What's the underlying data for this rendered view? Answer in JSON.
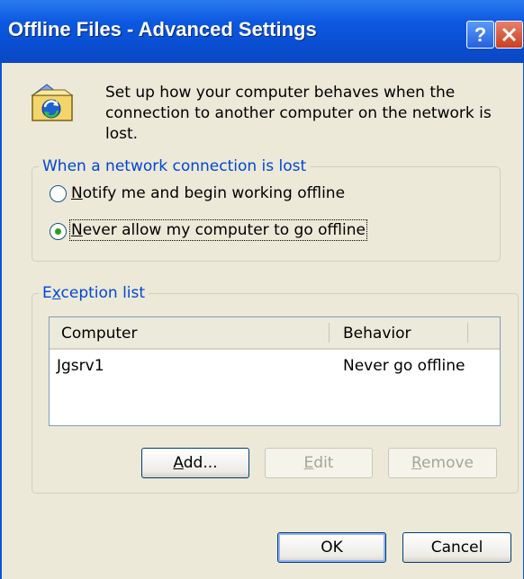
{
  "window": {
    "title": "Offline Files - Advanced Settings",
    "help_glyph": "?",
    "colors": {
      "titlebar": "#0a56d8",
      "client": "#ece9d8",
      "group_title": "#0046d5",
      "radio_dot": "#21a121"
    }
  },
  "description": "Set up how your computer behaves when the connection to another computer on the network is lost.",
  "icons": {
    "info": "offline-files-icon",
    "close": "close-icon",
    "help": "help-icon"
  },
  "network_group": {
    "title": "When a network connection is lost",
    "options": [
      {
        "mnemonic": "N",
        "rest": "otify me and begin working offline",
        "selected": false
      },
      {
        "mnemonic": "N",
        "rest": "ever allow my computer to go offline",
        "selected": true
      }
    ]
  },
  "exception_group": {
    "title_pre": "E",
    "title_mnemonic": "x",
    "title_post": "ception list",
    "columns": [
      "Computer",
      "Behavior"
    ],
    "rows": [
      {
        "computer": "Jgsrv1",
        "behavior": "Never go offline"
      }
    ],
    "buttons": {
      "add": {
        "mnemonic": "A",
        "rest": "dd..."
      },
      "edit": {
        "mnemonic": "E",
        "rest": "dit"
      },
      "remove": {
        "mnemonic": "R",
        "rest": "emove"
      }
    }
  },
  "footer": {
    "ok": "OK",
    "cancel": "Cancel"
  }
}
